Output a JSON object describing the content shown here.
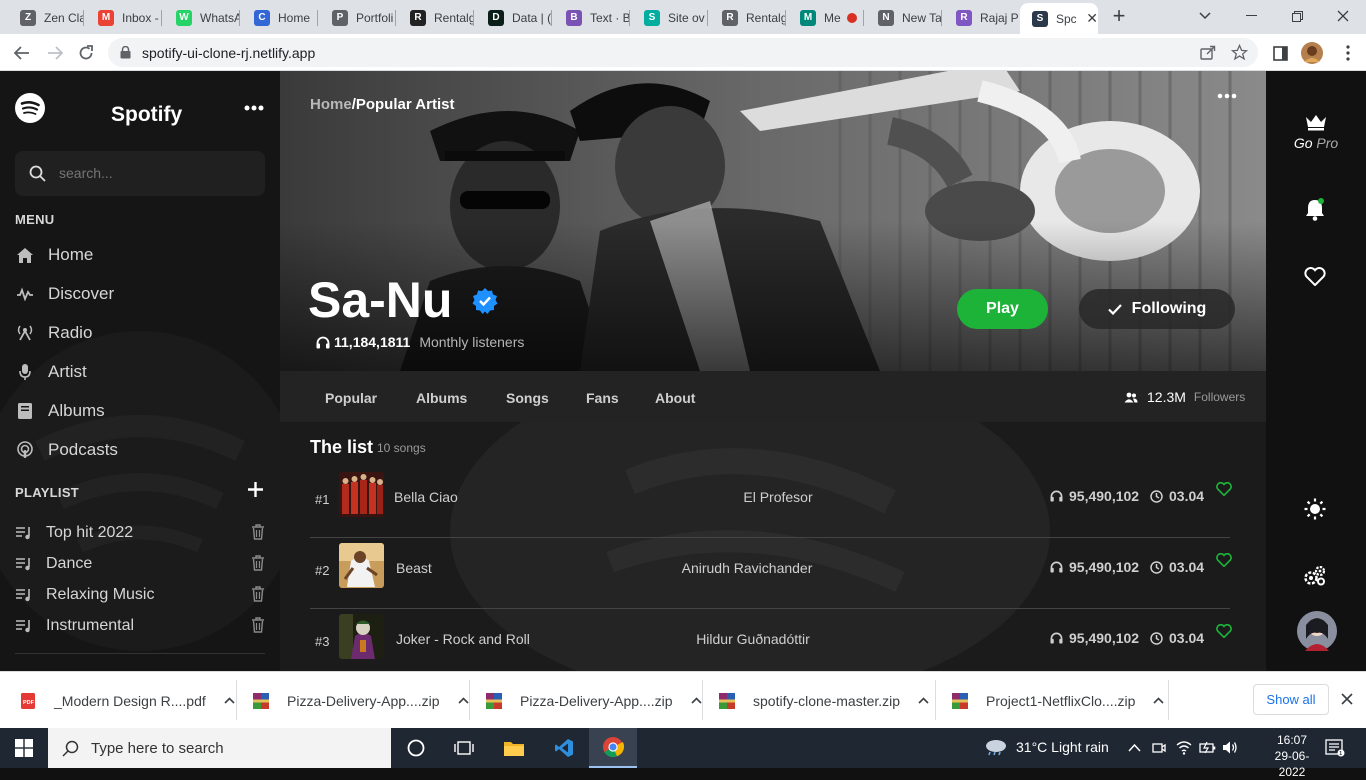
{
  "browser": {
    "tabs": [
      {
        "label": "Zen Cla",
        "fav_color": "#5f6368",
        "fav_glyph": "Z"
      },
      {
        "label": "Inbox -",
        "fav_color": "#ea4335",
        "fav_glyph": "M"
      },
      {
        "label": "WhatsA",
        "fav_color": "#25d366",
        "fav_glyph": "W"
      },
      {
        "label": "Home",
        "fav_color": "#3367d6",
        "fav_glyph": "C"
      },
      {
        "label": "Portfoli",
        "fav_color": "#5f6368",
        "fav_glyph": "P"
      },
      {
        "label": "Rentalg",
        "fav_color": "#222222",
        "fav_glyph": "R"
      },
      {
        "label": "Data | (",
        "fav_color": "#0b1f18",
        "fav_glyph": "D"
      },
      {
        "label": "Text · B",
        "fav_color": "#7952b3",
        "fav_glyph": "B"
      },
      {
        "label": "Site ov",
        "fav_color": "#00ad9f",
        "fav_glyph": "S"
      },
      {
        "label": "Rentalg",
        "fav_color": "#5f6368",
        "fav_glyph": "R"
      },
      {
        "label": "Me",
        "fav_color": "#00897b",
        "fav_glyph": "M"
      },
      {
        "label": "New Ta",
        "fav_color": "#5f6368",
        "fav_glyph": "N"
      },
      {
        "label": "Rajaj P",
        "fav_color": "#7e57c2",
        "fav_glyph": "R"
      },
      {
        "label": "Spc",
        "fav_color": "#2b3a4a",
        "fav_glyph": "S"
      }
    ],
    "url": "spotify-ui-clone-rj.netlify.app"
  },
  "sidebar": {
    "brand": "Spotify",
    "search_placeholder": "search...",
    "menu_title": "MENU",
    "menu": [
      {
        "label": "Home",
        "icon": "home-icon"
      },
      {
        "label": "Discover",
        "icon": "pulse-icon"
      },
      {
        "label": "Radio",
        "icon": "radio-icon"
      },
      {
        "label": "Artist",
        "icon": "microphone-icon"
      },
      {
        "label": "Albums",
        "icon": "album-icon"
      },
      {
        "label": "Podcasts",
        "icon": "podcast-icon"
      }
    ],
    "playlist_title": "PLAYLIST",
    "playlists": [
      "Top hit 2022",
      "Dance",
      "Relaxing Music",
      "Instrumental"
    ]
  },
  "hero": {
    "breadcrumb_home": "Home",
    "breadcrumb_current": "/Popular Artist",
    "artist": "Sa-Nu",
    "listeners": "11,184,1811",
    "listeners_label": "Monthly listeners",
    "play_label": "Play",
    "follow_label": "Following"
  },
  "tabs": {
    "items": [
      "Popular",
      "Albums",
      "Songs",
      "Fans",
      "About"
    ],
    "followers": "12.3M",
    "followers_label": "Followers"
  },
  "list": {
    "title": "The list",
    "count": "10 songs",
    "songs": [
      {
        "rank": "#1",
        "title": "Bella Ciao",
        "artist": "El Profesor",
        "plays": "95,490,102",
        "duration": "03.04"
      },
      {
        "rank": "#2",
        "title": "Beast",
        "artist": "Anirudh Ravichander",
        "plays": "95,490,102",
        "duration": "03.04"
      },
      {
        "rank": "#3",
        "title": "Joker - Rock and Roll",
        "artist": "Hildur Guðnadóttir",
        "plays": "95,490,102",
        "duration": "03.04"
      }
    ]
  },
  "rightbar": {
    "go": "Go",
    "pro": "Pro"
  },
  "downloads": {
    "items": [
      "_Modern Design R....pdf",
      "Pizza-Delivery-App....zip",
      "Pizza-Delivery-App....zip",
      "spotify-clone-master.zip",
      "Project1-NetflixClo....zip"
    ],
    "show_all": "Show all"
  },
  "taskbar": {
    "search_placeholder": "Type here to search",
    "weather": "31°C  Light rain",
    "time": "16:07",
    "date": "29-06-2022"
  },
  "colors": {
    "accent": "#1db238",
    "verified": "#1e90ff"
  }
}
